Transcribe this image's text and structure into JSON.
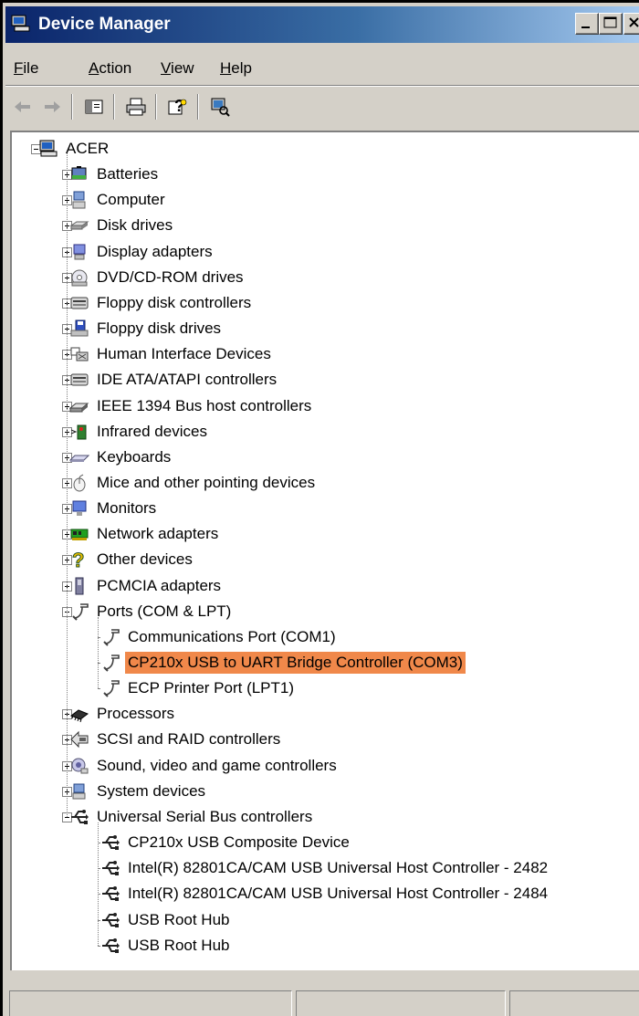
{
  "window": {
    "title": "Device Manager"
  },
  "menu": [
    {
      "label": "File",
      "accel": "F",
      "rest": "ile"
    },
    {
      "label": "Action",
      "accel": "A",
      "rest": "ction"
    },
    {
      "label": "View",
      "accel": "V",
      "rest": "iew"
    },
    {
      "label": "Help",
      "accel": "H",
      "rest": "elp"
    }
  ],
  "toolbar": [
    "back-icon",
    "forward-icon",
    "show-hide-console-tree-icon",
    "print-icon",
    "help-icon",
    "scan-hardware-icon"
  ],
  "tree": {
    "root": "ACER",
    "categories": [
      {
        "label": "Batteries",
        "icon": "battery-icon",
        "expanded": false
      },
      {
        "label": "Computer",
        "icon": "computer-icon",
        "expanded": false
      },
      {
        "label": "Disk drives",
        "icon": "disk-drive-icon",
        "expanded": false
      },
      {
        "label": "Display adapters",
        "icon": "display-adapter-icon",
        "expanded": false
      },
      {
        "label": "DVD/CD-ROM drives",
        "icon": "dvd-drive-icon",
        "expanded": false
      },
      {
        "label": "Floppy disk controllers",
        "icon": "floppy-controller-icon",
        "expanded": false
      },
      {
        "label": "Floppy disk drives",
        "icon": "floppy-drive-icon",
        "expanded": false
      },
      {
        "label": "Human Interface Devices",
        "icon": "hid-icon",
        "expanded": false
      },
      {
        "label": "IDE ATA/ATAPI controllers",
        "icon": "ide-controller-icon",
        "expanded": false
      },
      {
        "label": "IEEE 1394 Bus host controllers",
        "icon": "ieee1394-icon",
        "expanded": false
      },
      {
        "label": "Infrared devices",
        "icon": "infrared-icon",
        "expanded": false
      },
      {
        "label": "Keyboards",
        "icon": "keyboard-icon",
        "expanded": false
      },
      {
        "label": "Mice and other pointing devices",
        "icon": "mouse-icon",
        "expanded": false
      },
      {
        "label": "Monitors",
        "icon": "monitor-icon",
        "expanded": false
      },
      {
        "label": "Network adapters",
        "icon": "network-adapter-icon",
        "expanded": false
      },
      {
        "label": "Other devices",
        "icon": "unknown-device-icon",
        "expanded": false
      },
      {
        "label": "PCMCIA adapters",
        "icon": "pcmcia-icon",
        "expanded": false
      },
      {
        "label": "Ports (COM & LPT)",
        "icon": "port-icon",
        "expanded": true,
        "children": [
          {
            "label": "Communications Port (COM1)",
            "icon": "port-icon"
          },
          {
            "label": "CP210x USB to UART Bridge Controller (COM3)",
            "icon": "port-icon",
            "selected": true
          },
          {
            "label": "ECP Printer Port (LPT1)",
            "icon": "port-icon"
          }
        ]
      },
      {
        "label": "Processors",
        "icon": "processor-icon",
        "expanded": false
      },
      {
        "label": "SCSI and RAID controllers",
        "icon": "scsi-icon",
        "expanded": false
      },
      {
        "label": "Sound, video and game controllers",
        "icon": "sound-icon",
        "expanded": false
      },
      {
        "label": "System devices",
        "icon": "system-device-icon",
        "expanded": false
      },
      {
        "label": "Universal Serial Bus controllers",
        "icon": "usb-icon",
        "expanded": true,
        "children": [
          {
            "label": "CP210x USB Composite Device",
            "icon": "usb-icon"
          },
          {
            "label": "Intel(R) 82801CA/CAM USB Universal Host Controller - 2482",
            "icon": "usb-icon"
          },
          {
            "label": "Intel(R) 82801CA/CAM USB Universal Host Controller - 2484",
            "icon": "usb-icon"
          },
          {
            "label": "USB Root Hub",
            "icon": "usb-icon"
          },
          {
            "label": "USB Root Hub",
            "icon": "usb-icon"
          }
        ]
      }
    ]
  },
  "colors": {
    "selection": "#f0884a",
    "titlebar_start": "#0a246a",
    "titlebar_end": "#a6caf0",
    "face": "#d4d0c8"
  }
}
